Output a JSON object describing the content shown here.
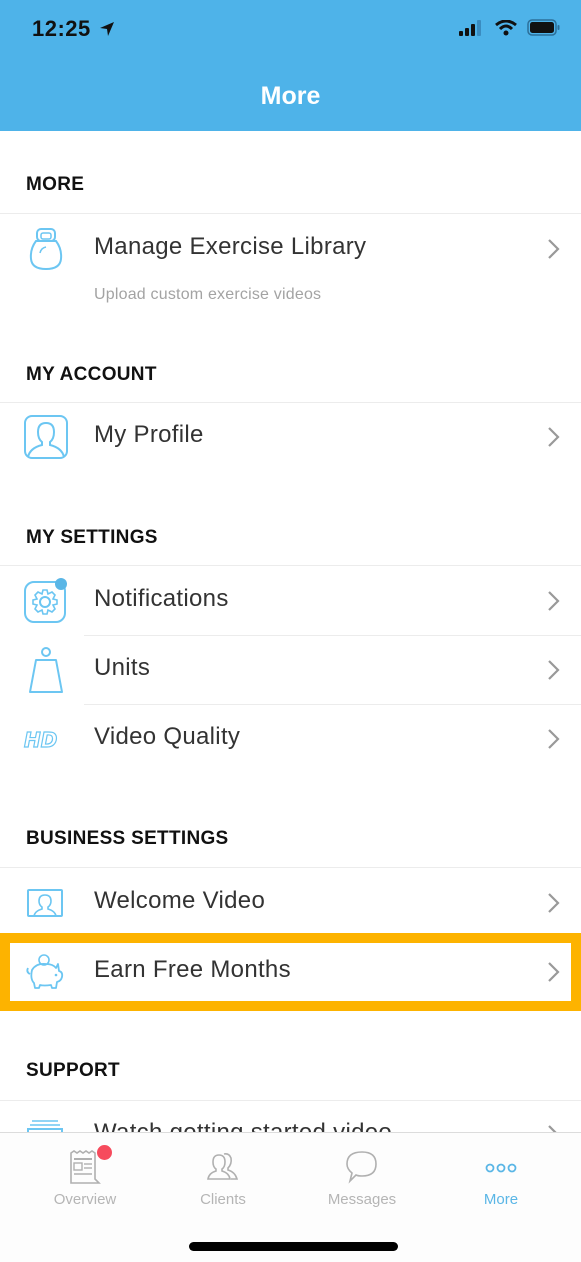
{
  "status_bar": {
    "time": "12:25",
    "location_icon": "location-arrow-icon",
    "signal_icon": "cellular-signal-icon",
    "wifi_icon": "wifi-icon",
    "battery_icon": "battery-icon"
  },
  "nav": {
    "title": "More"
  },
  "colors": {
    "header": "#4eb3e9",
    "accent": "#5ab6e6",
    "highlight": "#fdb300",
    "badge": "#f64b5d"
  },
  "sections": [
    {
      "title": "MORE",
      "items": [
        {
          "label": "Manage Exercise Library",
          "subtext": "Upload custom exercise videos",
          "icon": "kettlebell-icon"
        }
      ]
    },
    {
      "title": "MY ACCOUNT",
      "items": [
        {
          "label": "My Profile",
          "icon": "profile-icon"
        }
      ]
    },
    {
      "title": "MY SETTINGS",
      "items": [
        {
          "label": "Notifications",
          "icon": "settings-gear-icon",
          "has_dot": true
        },
        {
          "label": "Units",
          "icon": "weight-icon"
        },
        {
          "label": "Video Quality",
          "icon": "hd-icon"
        }
      ]
    },
    {
      "title": "BUSINESS SETTINGS",
      "items": [
        {
          "label": "Welcome Video",
          "icon": "welcome-video-icon"
        },
        {
          "label": "Earn Free Months",
          "icon": "piggy-bank-icon",
          "highlighted": true
        }
      ]
    },
    {
      "title": "SUPPORT",
      "items": [
        {
          "label": "Watch getting started video",
          "icon": "video-stack-icon"
        }
      ]
    }
  ],
  "tabbar": {
    "tabs": [
      {
        "label": "Overview",
        "icon": "newspaper-icon",
        "badge": true,
        "active": false
      },
      {
        "label": "Clients",
        "icon": "users-icon",
        "active": false
      },
      {
        "label": "Messages",
        "icon": "chat-bubble-icon",
        "active": false
      },
      {
        "label": "More",
        "icon": "more-dots-icon",
        "active": true
      }
    ]
  }
}
